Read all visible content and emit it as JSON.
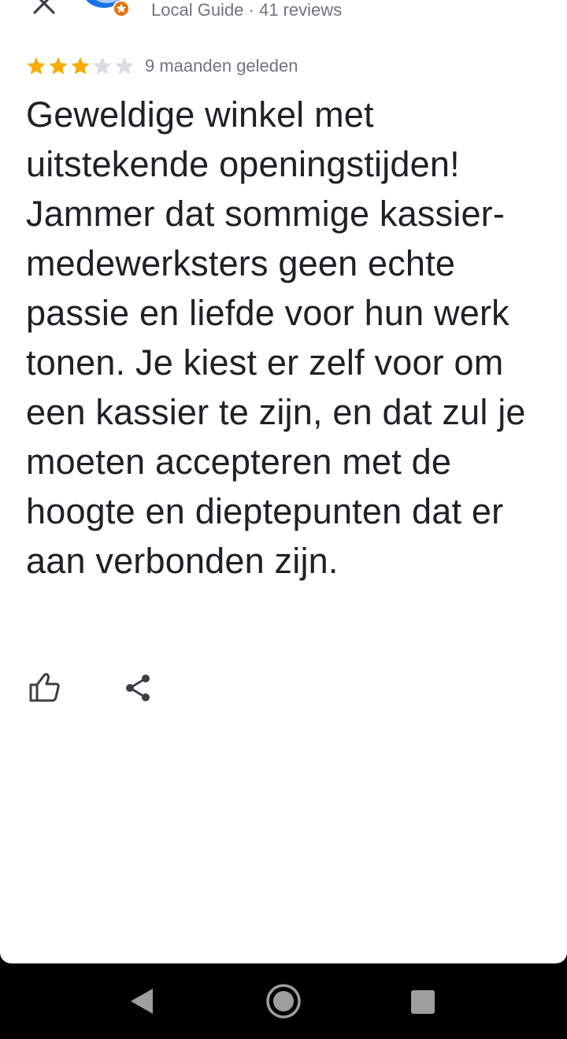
{
  "header": {
    "author_meta": "Local Guide · 41 reviews",
    "close_icon": "close-icon",
    "more_icon": "more-vert-icon"
  },
  "review": {
    "rating": 3,
    "rating_max": 5,
    "date": "9 maanden geleden",
    "text": "Geweldige winkel met uitstekende openingstijden! Jammer dat sommige kassier-medewerksters geen echte passie en liefde voor hun werk tonen. Je kiest er zelf voor om een kassier te zijn, en dat zul je moeten accepteren met de hoogte en dieptepunten dat er aan verbonden zijn."
  },
  "actions": {
    "like_icon": "thumb-up-icon",
    "share_icon": "share-icon"
  },
  "navbar": {
    "back_icon": "nav-back-icon",
    "home_icon": "nav-home-icon",
    "recent_icon": "nav-recent-apps-icon"
  },
  "colors": {
    "star_filled": "#f9ab00",
    "star_empty": "#dadce0",
    "secondary_text": "#70757a",
    "primary_text": "#202124",
    "icon": "#3c4043",
    "local_guide_badge": "#e8710a",
    "avatar": "#1a73e8"
  }
}
